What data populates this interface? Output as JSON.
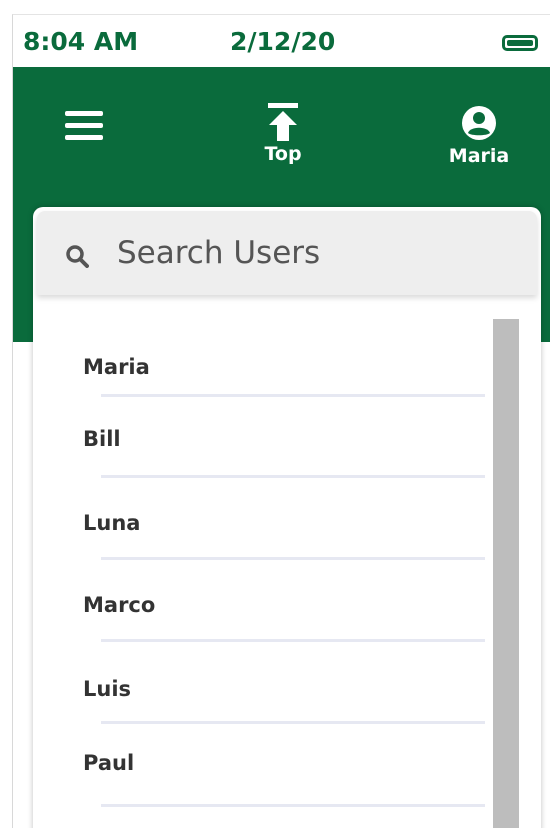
{
  "status_bar": {
    "time": "8:04 AM",
    "date": "2/12/20"
  },
  "header": {
    "top_label": "Top",
    "profile_label": "Maria"
  },
  "search": {
    "placeholder": "Search Users"
  },
  "users": [
    "Maria",
    "Bill",
    "Luna",
    "Marco",
    "Luis",
    "Paul"
  ],
  "colors": {
    "brand_green": "#0a6b3c",
    "scrollbar": "#bdbdbd",
    "divider": "#e6e8f2"
  },
  "icons": {
    "menu": "hamburger-menu-icon",
    "top": "arrow-to-top-icon",
    "profile": "user-circle-icon",
    "search": "search-icon",
    "battery": "battery-icon"
  }
}
